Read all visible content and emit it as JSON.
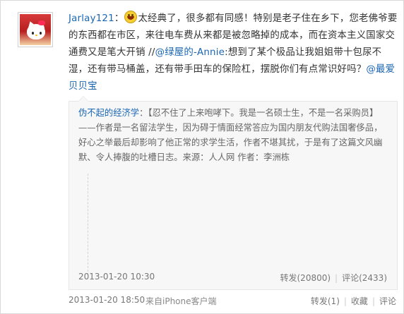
{
  "post": {
    "username": "Jarlay121",
    "segments": [
      {
        "type": "text",
        "text": "太经典了，很多都有同感！特别是老子住在乡下，您老佛爷要的东西都在市区，来往电车费从来都是被忽略掉的成本，而在资本主义国家交通费又是笔大开销 //"
      },
      {
        "type": "mention",
        "text": "@绿屋的-Annie"
      },
      {
        "type": "text",
        "text": ":想到了某个极品让我姐姐带十包尿不湿，还有带马桶盖，还有带手田车的保险杠，摆脱你们有点常识好吗？"
      },
      {
        "type": "mention",
        "text": "@最爱贝贝宝"
      }
    ],
    "emoji": "smile-emoji",
    "date": "2013-01-20 18:50",
    "source": "来自iPhone客户端",
    "actions": {
      "repost": "转发(1)",
      "favorite": "收藏",
      "comment": "评论"
    }
  },
  "repost": {
    "author": "伪不起的经济学",
    "body": "：【忍不住了上来咆哮下。我是一名硕士生，不是一名采购员】——作者是一名留法学生，因为碍于情面经常答应为国内朋友代购法国奢侈品，好心之举最后却影响了他正常的求学生活，作者不堪其扰，于是有了这篇文风幽默、令人捧腹的吐槽日志。来源：人人网 作者：李洲栋",
    "date": "2013-01-20 10:30",
    "actions": {
      "repost": "转发(20800)",
      "comment": "评论(2433)"
    }
  },
  "colors": {
    "link": "#1a66b3",
    "text": "#333333",
    "repost_bg": "#f7f7f7"
  }
}
